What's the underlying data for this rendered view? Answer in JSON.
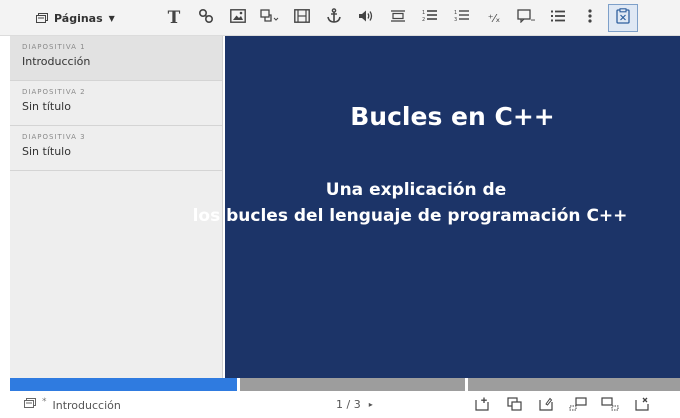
{
  "toolbar": {
    "pages_label": "Páginas",
    "tools": [
      {
        "icon": "text-icon",
        "label": "T"
      },
      {
        "icon": "link-icon"
      },
      {
        "icon": "image-icon"
      },
      {
        "icon": "shape-icon"
      },
      {
        "icon": "film-icon"
      },
      {
        "icon": "anchor-icon"
      },
      {
        "icon": "audio-icon"
      },
      {
        "icon": "align-icon"
      },
      {
        "icon": "numbered-list-icon"
      },
      {
        "icon": "ordered-list-icon"
      },
      {
        "icon": "fraction-icon",
        "label": "⁺⁄ₓ"
      },
      {
        "icon": "comment-icon"
      },
      {
        "icon": "bullet-list-icon"
      },
      {
        "icon": "more-icon"
      },
      {
        "icon": "clipboard-icon"
      }
    ]
  },
  "slides": [
    {
      "number": "DIAPOSITIVA 1",
      "title": "Introducción",
      "selected": true
    },
    {
      "number": "DIAPOSITIVA 2",
      "title": "Sin título"
    },
    {
      "number": "DIAPOSITIVA 3",
      "title": "Sin título"
    }
  ],
  "slide_content": {
    "title": "Bucles en C++",
    "subtitle_line1": "Una explicación de",
    "subtitle_line2": "los bucles del lenguaje de programación C++"
  },
  "status": {
    "current_title": "Introducción",
    "modified_marker": "*",
    "pager": "1 / 3",
    "next_symbol": "▸"
  },
  "progress": {
    "current": 1,
    "total": 3
  },
  "colors": {
    "slide_background": "#1c3468",
    "progress_active": "#2f7be0",
    "progress_inactive": "#9d9d9d"
  }
}
